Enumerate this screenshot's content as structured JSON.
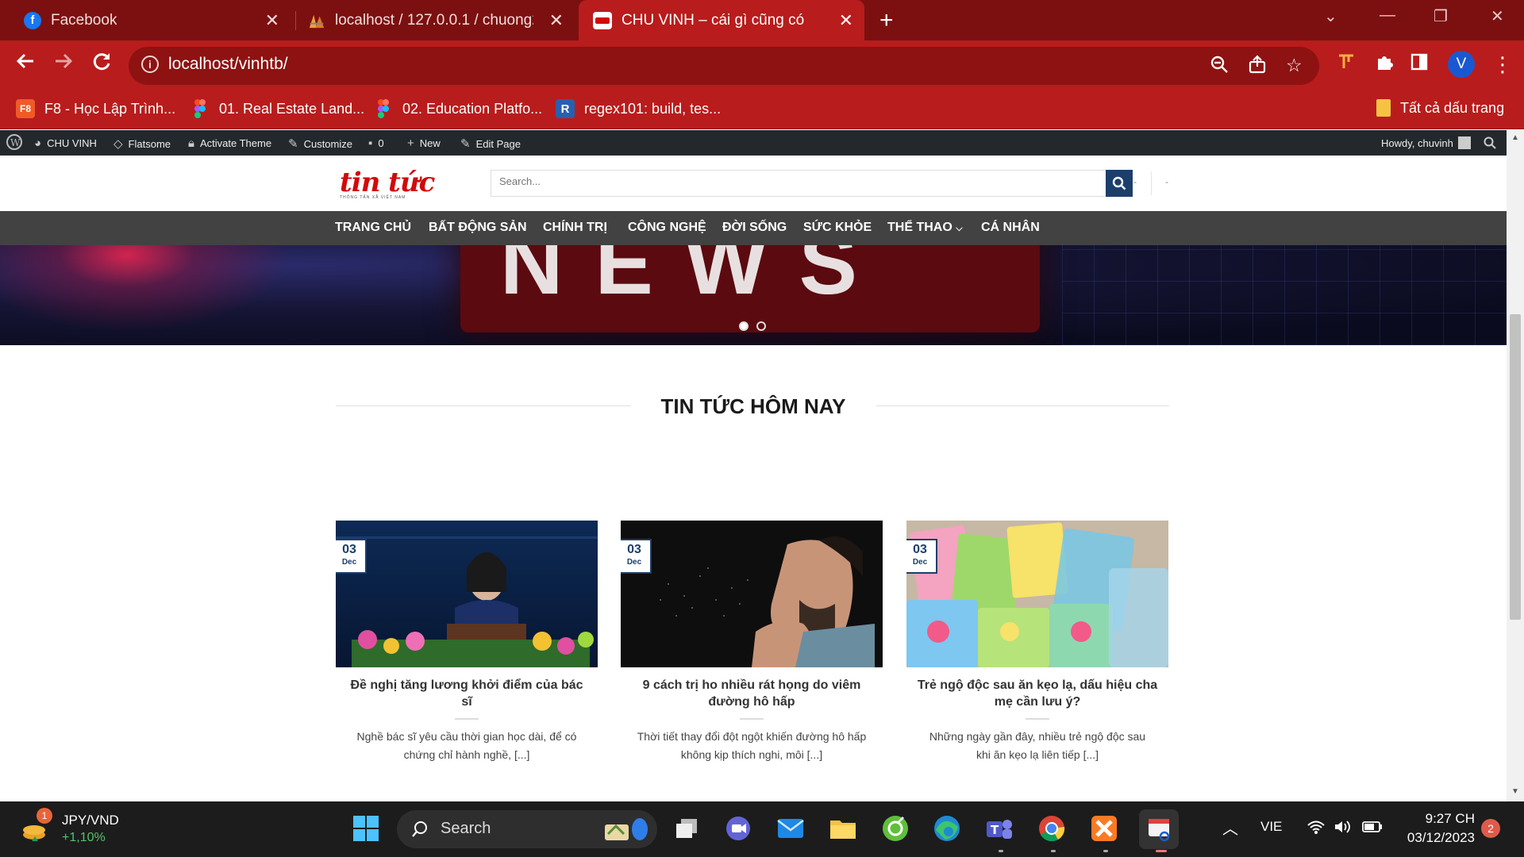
{
  "browser": {
    "tabs": [
      {
        "title": "Facebook",
        "favicon": "facebook-icon"
      },
      {
        "title": "localhost / 127.0.0.1 / chuong2 |",
        "favicon": "phpmyadmin-icon"
      },
      {
        "title": "CHU VINH – cái gì cũng có",
        "favicon": "site-icon",
        "active": true
      }
    ],
    "url": "localhost/vinhtb/",
    "bookmarks": [
      {
        "label": "F8 - Học Lập Trình...",
        "icon": "F8"
      },
      {
        "label": "01. Real Estate Land...",
        "icon": "figma-icon"
      },
      {
        "label": "02. Education Platfo...",
        "icon": "figma-icon"
      },
      {
        "label": "regex101: build, tes...",
        "icon": "R"
      }
    ],
    "all_bookmarks": "Tất cả dấu trang",
    "profile_initial": "V"
  },
  "wpbar": {
    "site": "CHU VINH",
    "theme": "Flatsome",
    "activate": "Activate Theme",
    "customize": "Customize",
    "comments": "0",
    "new": "New",
    "edit": "Edit Page",
    "howdy": "Howdy, chuvinh"
  },
  "header": {
    "logo_text": "tin tức",
    "logo_sub": "THÔNG TẤN XÃ VIỆT NAM",
    "search_placeholder": "Search...",
    "dash1": "-",
    "dash2": "-"
  },
  "nav": [
    "TRANG CHỦ",
    "BẤT ĐỘNG SẢN",
    "CHÍNH TRỊ",
    "CÔNG NGHỆ",
    "ĐỜI SỐNG",
    "SỨC KHỎE",
    "THỂ THAO",
    "CÁ NHÂN"
  ],
  "section_title": "TIN TỨC HÔM NAY",
  "posts": [
    {
      "day": "03",
      "month": "Dec",
      "title": "Đề nghị tăng lương khởi điểm của bác sĩ",
      "excerpt": "Nghề bác sĩ yêu cầu thời gian học dài, để có chứng chỉ hành nghề, [...]"
    },
    {
      "day": "03",
      "month": "Dec",
      "title": "9 cách trị ho nhiều rát họng do viêm đường hô hấp",
      "excerpt": "Thời tiết thay đổi đột ngột khiến đường hô hấp không kịp thích nghi, môi [...]"
    },
    {
      "day": "03",
      "month": "Dec",
      "title": "Trẻ ngộ độc sau ăn kẹo lạ, dấu hiệu cha mẹ cần lưu ý?",
      "excerpt": "Những ngày gần đây, nhiều trẻ ngộ độc sau khi ăn kẹo lạ liên tiếp [...]"
    }
  ],
  "taskbar": {
    "widget_title": "JPY/VND",
    "widget_change": "+1,10%",
    "widget_badge": "1",
    "search_label": "Search",
    "lang": "VIE",
    "time": "9:27 CH",
    "date": "03/12/2023",
    "notif_count": "2"
  },
  "colors": {
    "chrome_red": "#b91c1c",
    "tab_strip": "#7c1010",
    "nav_bg": "#424242",
    "accent_blue": "#1b3f6b"
  }
}
